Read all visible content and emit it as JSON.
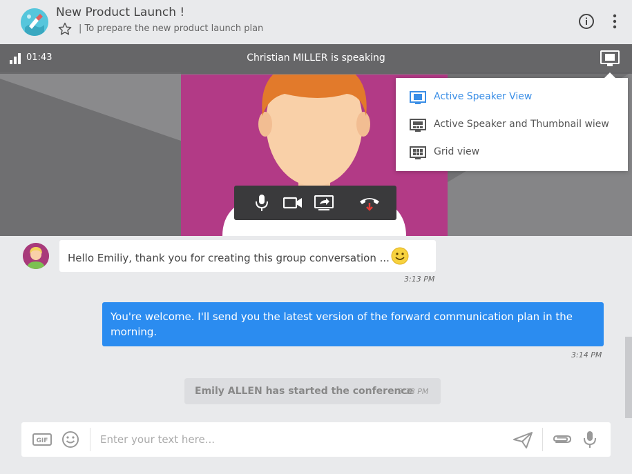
{
  "header": {
    "title": "New Product Launch !",
    "subtitle": "| To prepare the new product launch plan"
  },
  "video": {
    "timer": "01:43",
    "speaking_text": "Christian MILLER is speaking"
  },
  "view_menu": {
    "items": [
      {
        "label": "Active Speaker View",
        "active": true
      },
      {
        "label": "Active Speaker and Thumbnail wiew",
        "active": false
      },
      {
        "label": "Grid view",
        "active": false
      }
    ]
  },
  "chat": {
    "messages": [
      {
        "text": "Hello Emiliy, thank you for creating this group conversation ...",
        "time": "3:13 PM"
      },
      {
        "text": "You're welcome. I'll send you the latest version of the forward communication plan in the morning.",
        "time": "3:14 PM"
      }
    ],
    "system": {
      "text": "Emily ALLEN has started the conference",
      "time": "3:28 PM"
    }
  },
  "composer": {
    "placeholder": "Enter your text here..."
  },
  "colors": {
    "accent": "#2b8cf0",
    "speaker_bg": "#b23a86",
    "hangup": "#e53935"
  }
}
